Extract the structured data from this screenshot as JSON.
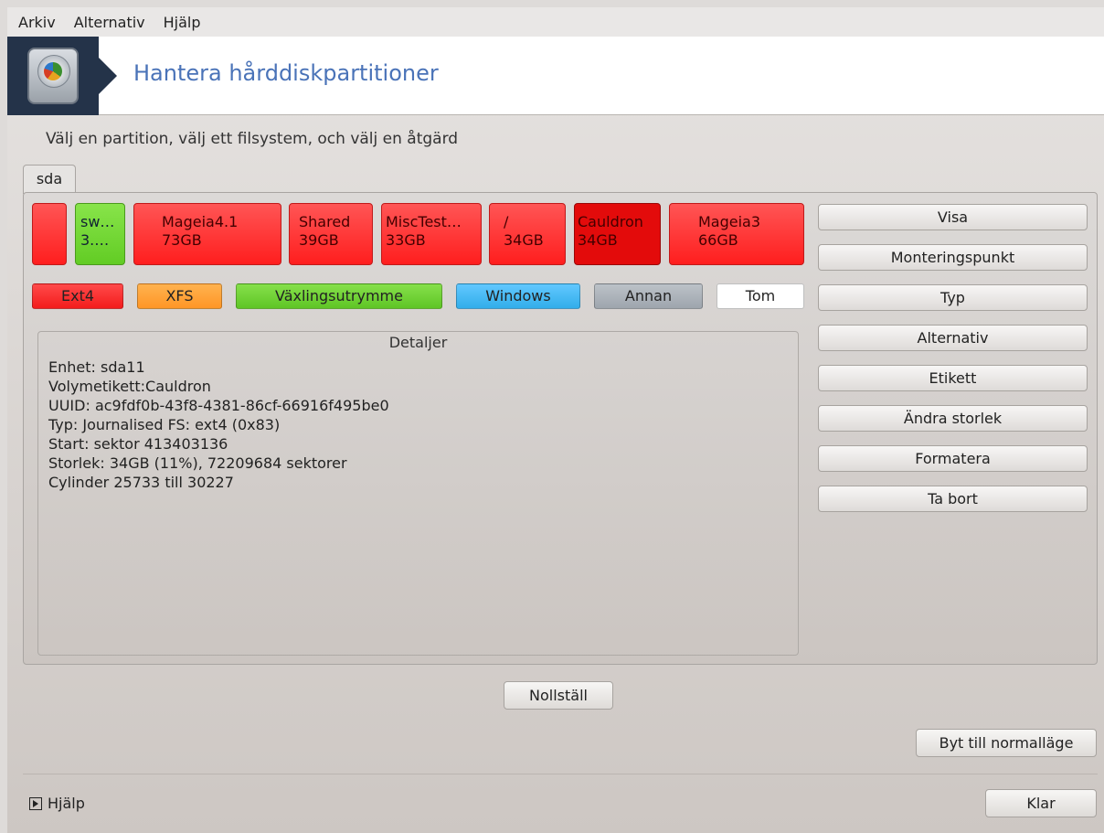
{
  "menubar": {
    "items": [
      "Arkiv",
      "Alternativ",
      "Hjälp"
    ]
  },
  "banner": {
    "title": "Hantera hårddiskpartitioner",
    "icon": "harddisk-icon"
  },
  "instruction": "Välj en partition, välj ett filsystem, och välj en åtgärd",
  "tabs": [
    {
      "label": "sda"
    }
  ],
  "partitions": [
    {
      "line1": "",
      "line2": "",
      "type": "ext4"
    },
    {
      "line1": "sw…",
      "line2": "3.…",
      "type": "swap"
    },
    {
      "line1": "Mageia4.1",
      "line2": "73GB",
      "type": "ext4"
    },
    {
      "line1": "Shared",
      "line2": "39GB",
      "type": "ext4"
    },
    {
      "line1": "MiscTest…",
      "line2": "33GB",
      "type": "ext4"
    },
    {
      "line1": "/",
      "line2": "34GB",
      "type": "ext4"
    },
    {
      "line1": "Cauldron",
      "line2": "34GB",
      "type": "ext4",
      "selected": true
    },
    {
      "line1": "Mageia3",
      "line2": "66GB",
      "type": "ext4"
    }
  ],
  "legend": [
    {
      "label": "Ext4",
      "color": "#ff2a2a"
    },
    {
      "label": "XFS",
      "color": "#ffa033"
    },
    {
      "label": "Växlingsutrymme",
      "color": "#6ccf2e"
    },
    {
      "label": "Windows",
      "color": "#3fb5f0"
    },
    {
      "label": "Annan",
      "color": "#a9afb6"
    },
    {
      "label": "Tom",
      "color": "#ffffff"
    }
  ],
  "actions": [
    "Visa",
    "Monteringspunkt",
    "Typ",
    "Alternativ",
    "Etikett",
    "Ändra storlek",
    "Formatera",
    "Ta bort"
  ],
  "details": {
    "title": "Detaljer",
    "lines": [
      "Enhet: sda11",
      "Volymetikett:Cauldron",
      "UUID: ac9fdf0b-43f8-4381-86cf-66916f495be0",
      "Typ: Journalised FS: ext4 (0x83)",
      "Start: sektor 413403136",
      "Storlek: 34GB (11%), 72209684 sektorer",
      "Cylinder 25733 till 30227"
    ]
  },
  "buttons": {
    "reset": "Nollställ",
    "normal_mode": "Byt till normalläge",
    "done": "Klar"
  },
  "footer": {
    "help": "Hjälp"
  }
}
